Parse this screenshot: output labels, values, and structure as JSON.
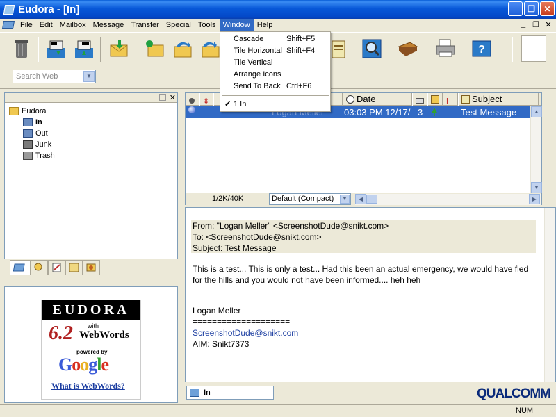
{
  "window": {
    "title": "Eudora - [In]",
    "minimize": "_",
    "maximize": "❐",
    "close": "✕"
  },
  "menubar": {
    "items": [
      "File",
      "Edit",
      "Mailbox",
      "Message",
      "Transfer",
      "Special",
      "Tools",
      "Window",
      "Help"
    ],
    "active": "Window",
    "mdi_minimize": "_",
    "mdi_restore": "❐",
    "mdi_close": "✕"
  },
  "window_menu": {
    "items": [
      {
        "label": "Cascade",
        "shortcut": "Shift+F5"
      },
      {
        "label": "Tile Horizontal",
        "shortcut": "Shift+F4"
      },
      {
        "label": "Tile Vertical",
        "shortcut": ""
      },
      {
        "label": "Arrange Icons",
        "shortcut": ""
      },
      {
        "label": "Send To Back",
        "shortcut": "Ctrl+F6"
      },
      {
        "label": "1 In",
        "shortcut": "",
        "checked": true
      }
    ],
    "check_mark": "✔"
  },
  "search": {
    "placeholder": "Search Web"
  },
  "mailbox_tree": {
    "root": "Eudora",
    "children": [
      {
        "label": "In",
        "bold": true
      },
      {
        "label": "Out",
        "bold": false
      },
      {
        "label": "Junk",
        "bold": false
      },
      {
        "label": "Trash",
        "bold": false
      }
    ],
    "close": "✕"
  },
  "ad": {
    "brand": "EUDORA",
    "version": "6.2",
    "with": "with",
    "webwords": "WebWords",
    "powered_by": "powered by",
    "google": "Google",
    "what_link": "What is WebWords?"
  },
  "message_list": {
    "columns": [
      "",
      "",
      "",
      "Date",
      "",
      "",
      "",
      "Subject"
    ],
    "date_header": "Date",
    "subject_header": "Subject",
    "rows": [
      {
        "who": "Logan Meller",
        "date": "03:03 PM 12/17/",
        "size": "3",
        "subject": "Test Message"
      }
    ],
    "status_size": "1/2K/40K",
    "view_mode": "Default (Compact)"
  },
  "preview": {
    "from": "From: \"Logan Meller\" <ScreenshotDude@snikt.com>",
    "to": "To: <ScreenshotDude@snikt.com>",
    "subject": "Subject: Test Message",
    "body_line1": "This is a test... This is only a test... Had this been an actual emergency, we would have fled",
    "body_line2": "for the hills and you would not have been informed.... heh heh",
    "sig_name": "Logan Meller",
    "sig_rule": "====================",
    "sig_email": "ScreenshotDude@snikt.com",
    "sig_aim": "AIM: Snikt7373"
  },
  "bottom_tab": {
    "label": "In"
  },
  "logo": "QUALCOMM",
  "statusbar": {
    "num": "NUM"
  }
}
